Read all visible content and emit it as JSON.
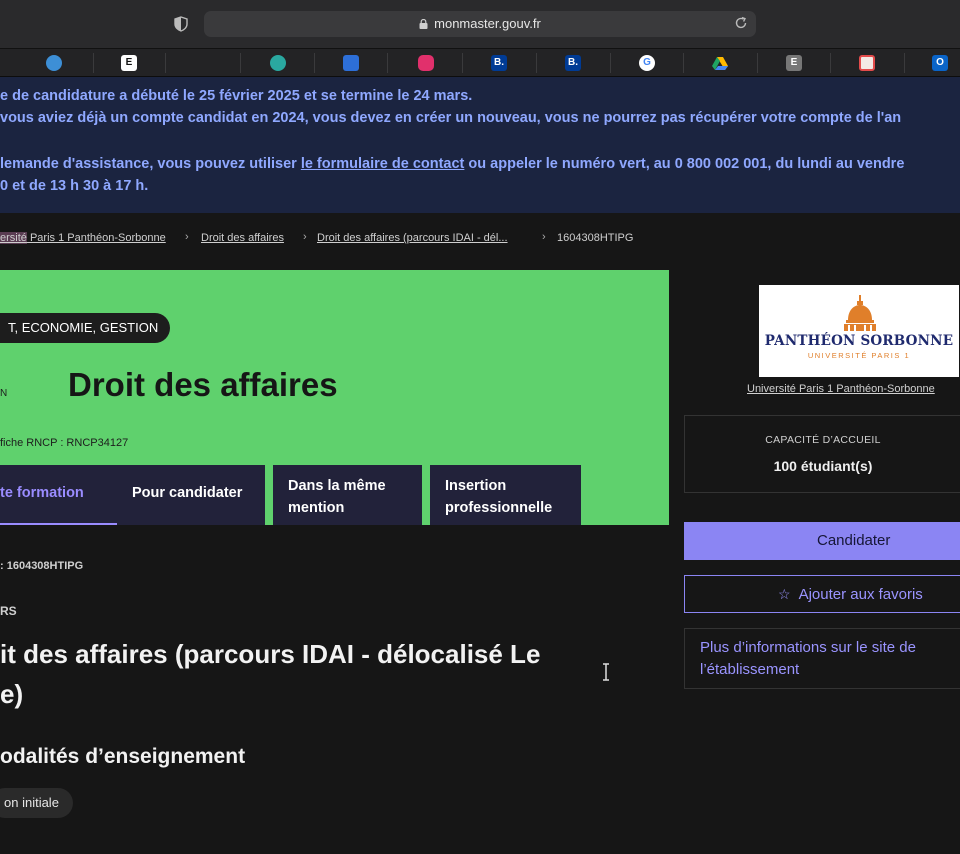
{
  "browser": {
    "url": "monmaster.gouv.fr"
  },
  "bookmarks": [
    {
      "icon": "cloud-icon",
      "color": "#3d8fd6",
      "label": ""
    },
    {
      "icon": "e-letter-icon",
      "color": "#ffffff",
      "label": "E"
    },
    {
      "icon": "globe-icon",
      "color": "#2aa8a0",
      "label": ""
    },
    {
      "icon": "calendar-icon",
      "color": "#2d6fd8",
      "label": ""
    },
    {
      "icon": "instagram-icon",
      "color": "#e1306c",
      "label": ""
    },
    {
      "icon": "booking-icon",
      "color": "#003b95",
      "label": "B."
    },
    {
      "icon": "booking-icon",
      "color": "#003b95",
      "label": "B."
    },
    {
      "icon": "google-icon",
      "color": "#ffffff",
      "label": "G"
    },
    {
      "icon": "drive-icon",
      "color": "#1fa463",
      "label": ""
    },
    {
      "icon": "e-grey-icon",
      "color": "#777777",
      "label": "E"
    },
    {
      "icon": "app-red-icon",
      "color": "#e34b4b",
      "label": ""
    },
    {
      "icon": "outlook-icon",
      "color": "#0a64c8",
      "label": "O"
    }
  ],
  "notice": {
    "line1": "e de candidature a débuté le 25 février 2025 et se termine le 24 mars.",
    "line2": "vous aviez déjà un compte candidat en 2024, vous devez en créer un nouveau, vous ne pourrez pas récupérer votre compte de l'an",
    "line3_before": "lemande d'assistance, vous pouvez utiliser ",
    "line3_link": "le formulaire de contact",
    "line3_after": " ou appeler le numéro vert, au 0 800 002 001, du lundi au vendre",
    "line4": "0 et de 13 h 30 à 17 h."
  },
  "breadcrumb": {
    "item1_hl": "ersité",
    "item1": " Paris 1 Panthéon-Sorbonne",
    "item2": "Droit des affaires",
    "item3": "Droit des affaires (parcours IDAI - dél...",
    "current": "1604308HTIPG"
  },
  "hero": {
    "domain": "T, ECONOMIE, GESTION",
    "level": "N",
    "title": "Droit des affaires",
    "rncp": "fiche RNCP : RNCP34127",
    "tabs": [
      {
        "line1": "te formation",
        "line2": ""
      },
      {
        "line1": "Pour candidater",
        "line2": ""
      },
      {
        "line1": "Dans la même",
        "line2": "mention"
      },
      {
        "line1": "Insertion",
        "line2": "professionnelle"
      }
    ]
  },
  "main": {
    "code": ": 1604308HTIPG",
    "kicker": "RS",
    "parcours_line1": "it des affaires (parcours IDAI - délocalisé Le",
    "parcours_line2": "e)",
    "modalites": "odalités d’enseignement",
    "modalite_tag": "on initiale"
  },
  "sidebar": {
    "logo_name": "PANTHÉON SORBONNE",
    "logo_sub": "UNIVERSITÉ PARIS 1",
    "logo_caption": "Université Paris 1 Panthéon-Sorbonne",
    "capacity_label": "CAPACITÉ D’ACCUEIL",
    "capacity_value": "100 étudiant(s)",
    "apply": "Candidater",
    "favorite": "Ajouter aux favoris",
    "info_line1": "Plus d’informations sur le site de",
    "info_line2": "l’établissement"
  },
  "colors": {
    "hero_green": "#5fd16d",
    "accent_purple": "#8b85f3",
    "notice_bg": "#1b2440",
    "notice_text": "#8fa8ff"
  }
}
